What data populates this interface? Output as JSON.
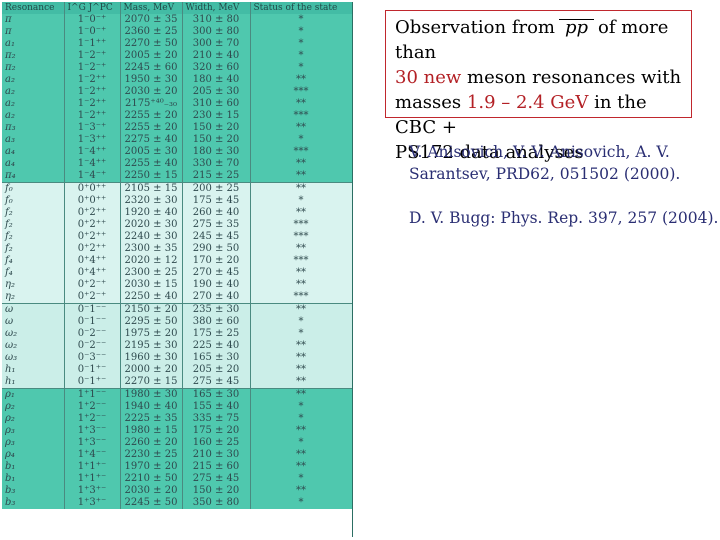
{
  "table": {
    "headers": [
      "Resonance",
      "I^G J^PC",
      "Mass, MeV",
      "Width, MeV",
      "Status of the state"
    ],
    "rows": [
      [
        "π",
        "1⁻0⁻⁺",
        "2070 ± 35",
        "310 ± 80",
        "*",
        "g1"
      ],
      [
        "π",
        "1⁻0⁻⁺",
        "2360 ± 25",
        "300 ± 80",
        "*",
        "g1"
      ],
      [
        "a₁",
        "1⁻1⁺⁺",
        "2270 ± 50",
        "300 ± 70",
        "*",
        "g1"
      ],
      [
        "π₂",
        "1⁻2⁻⁺",
        "2005 ± 20",
        "210 ± 40",
        "*",
        "g1"
      ],
      [
        "π₂",
        "1⁻2⁻⁺",
        "2245 ± 60",
        "320 ± 60",
        "*",
        "g1"
      ],
      [
        "a₂",
        "1⁻2⁺⁺",
        "1950 ± 30",
        "180 ± 40",
        "**",
        "g1"
      ],
      [
        "a₂",
        "1⁻2⁺⁺",
        "2030 ± 20",
        "205 ± 30",
        "***",
        "g1"
      ],
      [
        "a₂",
        "1⁻2⁺⁺",
        "2175⁺⁴⁰₋₃₀",
        "310 ± 60",
        "**",
        "g1"
      ],
      [
        "a₂",
        "1⁻2⁺⁺",
        "2255 ± 20",
        "230 ± 15",
        "***",
        "g1"
      ],
      [
        "π₃",
        "1⁻3⁻⁺",
        "2255 ± 20",
        "150 ± 20",
        "**",
        "g1"
      ],
      [
        "a₃",
        "1⁻3⁺⁺",
        "2275 ± 40",
        "150 ± 20",
        "*",
        "g1"
      ],
      [
        "a₄",
        "1⁻4⁺⁺",
        "2005 ± 30",
        "180 ± 30",
        "***",
        "g1"
      ],
      [
        "a₄",
        "1⁻4⁺⁺",
        "2255 ± 40",
        "330 ± 70",
        "**",
        "g1"
      ],
      [
        "π₄",
        "1⁻4⁻⁺",
        "2250 ± 15",
        "215 ± 25",
        "**",
        "g1"
      ],
      [
        "f₀",
        "0⁺0⁺⁺",
        "2105 ± 15",
        "200 ± 25",
        "**",
        "g2 sep"
      ],
      [
        "f₀",
        "0⁺0⁺⁺",
        "2320 ± 30",
        "175 ± 45",
        "*",
        "g2"
      ],
      [
        "f₂",
        "0⁺2⁺⁺",
        "1920 ± 40",
        "260 ± 40",
        "**",
        "g2"
      ],
      [
        "f₂",
        "0⁺2⁺⁺",
        "2020 ± 30",
        "275 ± 35",
        "***",
        "g2"
      ],
      [
        "f₂",
        "0⁺2⁺⁺",
        "2240 ± 30",
        "245 ± 45",
        "***",
        "g2"
      ],
      [
        "f₂",
        "0⁺2⁺⁺",
        "2300 ± 35",
        "290 ± 50",
        "**",
        "g2"
      ],
      [
        "f₄",
        "0⁺4⁺⁺",
        "2020 ± 12",
        "170 ± 20",
        "***",
        "g2"
      ],
      [
        "f₄",
        "0⁺4⁺⁺",
        "2300 ± 25",
        "270 ± 45",
        "**",
        "g2"
      ],
      [
        "η₂",
        "0⁺2⁻⁺",
        "2030 ± 15",
        "190 ± 40",
        "**",
        "g2"
      ],
      [
        "η₂",
        "0⁺2⁻⁺",
        "2250 ± 40",
        "270 ± 40",
        "***",
        "g2"
      ],
      [
        "ω",
        "0⁻1⁻⁻",
        "2150 ± 20",
        "235 ± 30",
        "**",
        "g2b sep"
      ],
      [
        "ω",
        "0⁻1⁻⁻",
        "2295 ± 50",
        "380 ± 60",
        "*",
        "g2b"
      ],
      [
        "ω₂",
        "0⁻2⁻⁻",
        "1975 ± 20",
        "175 ± 25",
        "*",
        "g2b"
      ],
      [
        "ω₂",
        "0⁻2⁻⁻",
        "2195 ± 30",
        "225 ± 40",
        "**",
        "g2b"
      ],
      [
        "ω₃",
        "0⁻3⁻⁻",
        "1960 ± 30",
        "165 ± 30",
        "**",
        "g2b"
      ],
      [
        "h₁",
        "0⁻1⁺⁻",
        "2000 ± 20",
        "205 ± 20",
        "**",
        "g2b"
      ],
      [
        "h₁",
        "0⁻1⁺⁻",
        "2270 ± 15",
        "275 ± 45",
        "**",
        "g2b"
      ],
      [
        "ρ₁",
        "1⁺1⁻⁻",
        "1980 ± 30",
        "165 ± 30",
        "**",
        "g3 sep"
      ],
      [
        "ρ₂",
        "1⁺2⁻⁻",
        "1940 ± 40",
        "155 ± 40",
        "*",
        "g3"
      ],
      [
        "ρ₂",
        "1⁺2⁻⁻",
        "2225 ± 35",
        "335 ± 75",
        "*",
        "g3"
      ],
      [
        "ρ₃",
        "1⁺3⁻⁻",
        "1980 ± 15",
        "175 ± 20",
        "**",
        "g3"
      ],
      [
        "ρ₃",
        "1⁺3⁻⁻",
        "2260 ± 20",
        "160 ± 25",
        "*",
        "g3"
      ],
      [
        "ρ₄",
        "1⁺4⁻⁻",
        "2230 ± 25",
        "210 ± 30",
        "**",
        "g3"
      ],
      [
        "b₁",
        "1⁺1⁺⁻",
        "1970 ± 20",
        "215 ± 60",
        "**",
        "g3"
      ],
      [
        "b₁",
        "1⁺1⁺⁻",
        "2210 ± 50",
        "275 ± 45",
        "*",
        "g3"
      ],
      [
        "b₃",
        "1⁺3⁺⁻",
        "2030 ± 20",
        "150 ± 20",
        "**",
        "g3"
      ],
      [
        "b₃",
        "1⁺3⁺⁻",
        "2245 ± 50",
        "350 ± 80",
        "*",
        "g3"
      ]
    ]
  },
  "observation": {
    "line1_a": "Observation from",
    "pp": "pp",
    "line1_b": "of more than",
    "line2_red": "30 new",
    "line2_rest": " meson resonances with",
    "line3_a": "masses ",
    "line3_red": "1.9 – 2.4 GeV",
    "line3_b": " in the CBC +",
    "line4": "PS172 data analyses"
  },
  "references": {
    "ref1_line1": "V. Anisovich, V. V. Anisovich, A. V.",
    "ref1_line2": "Sarantsev,  PRD62, 051502 (2000).",
    "ref2": "D. V. Bugg: Phys. Rep. 397, 257 (2004)."
  }
}
